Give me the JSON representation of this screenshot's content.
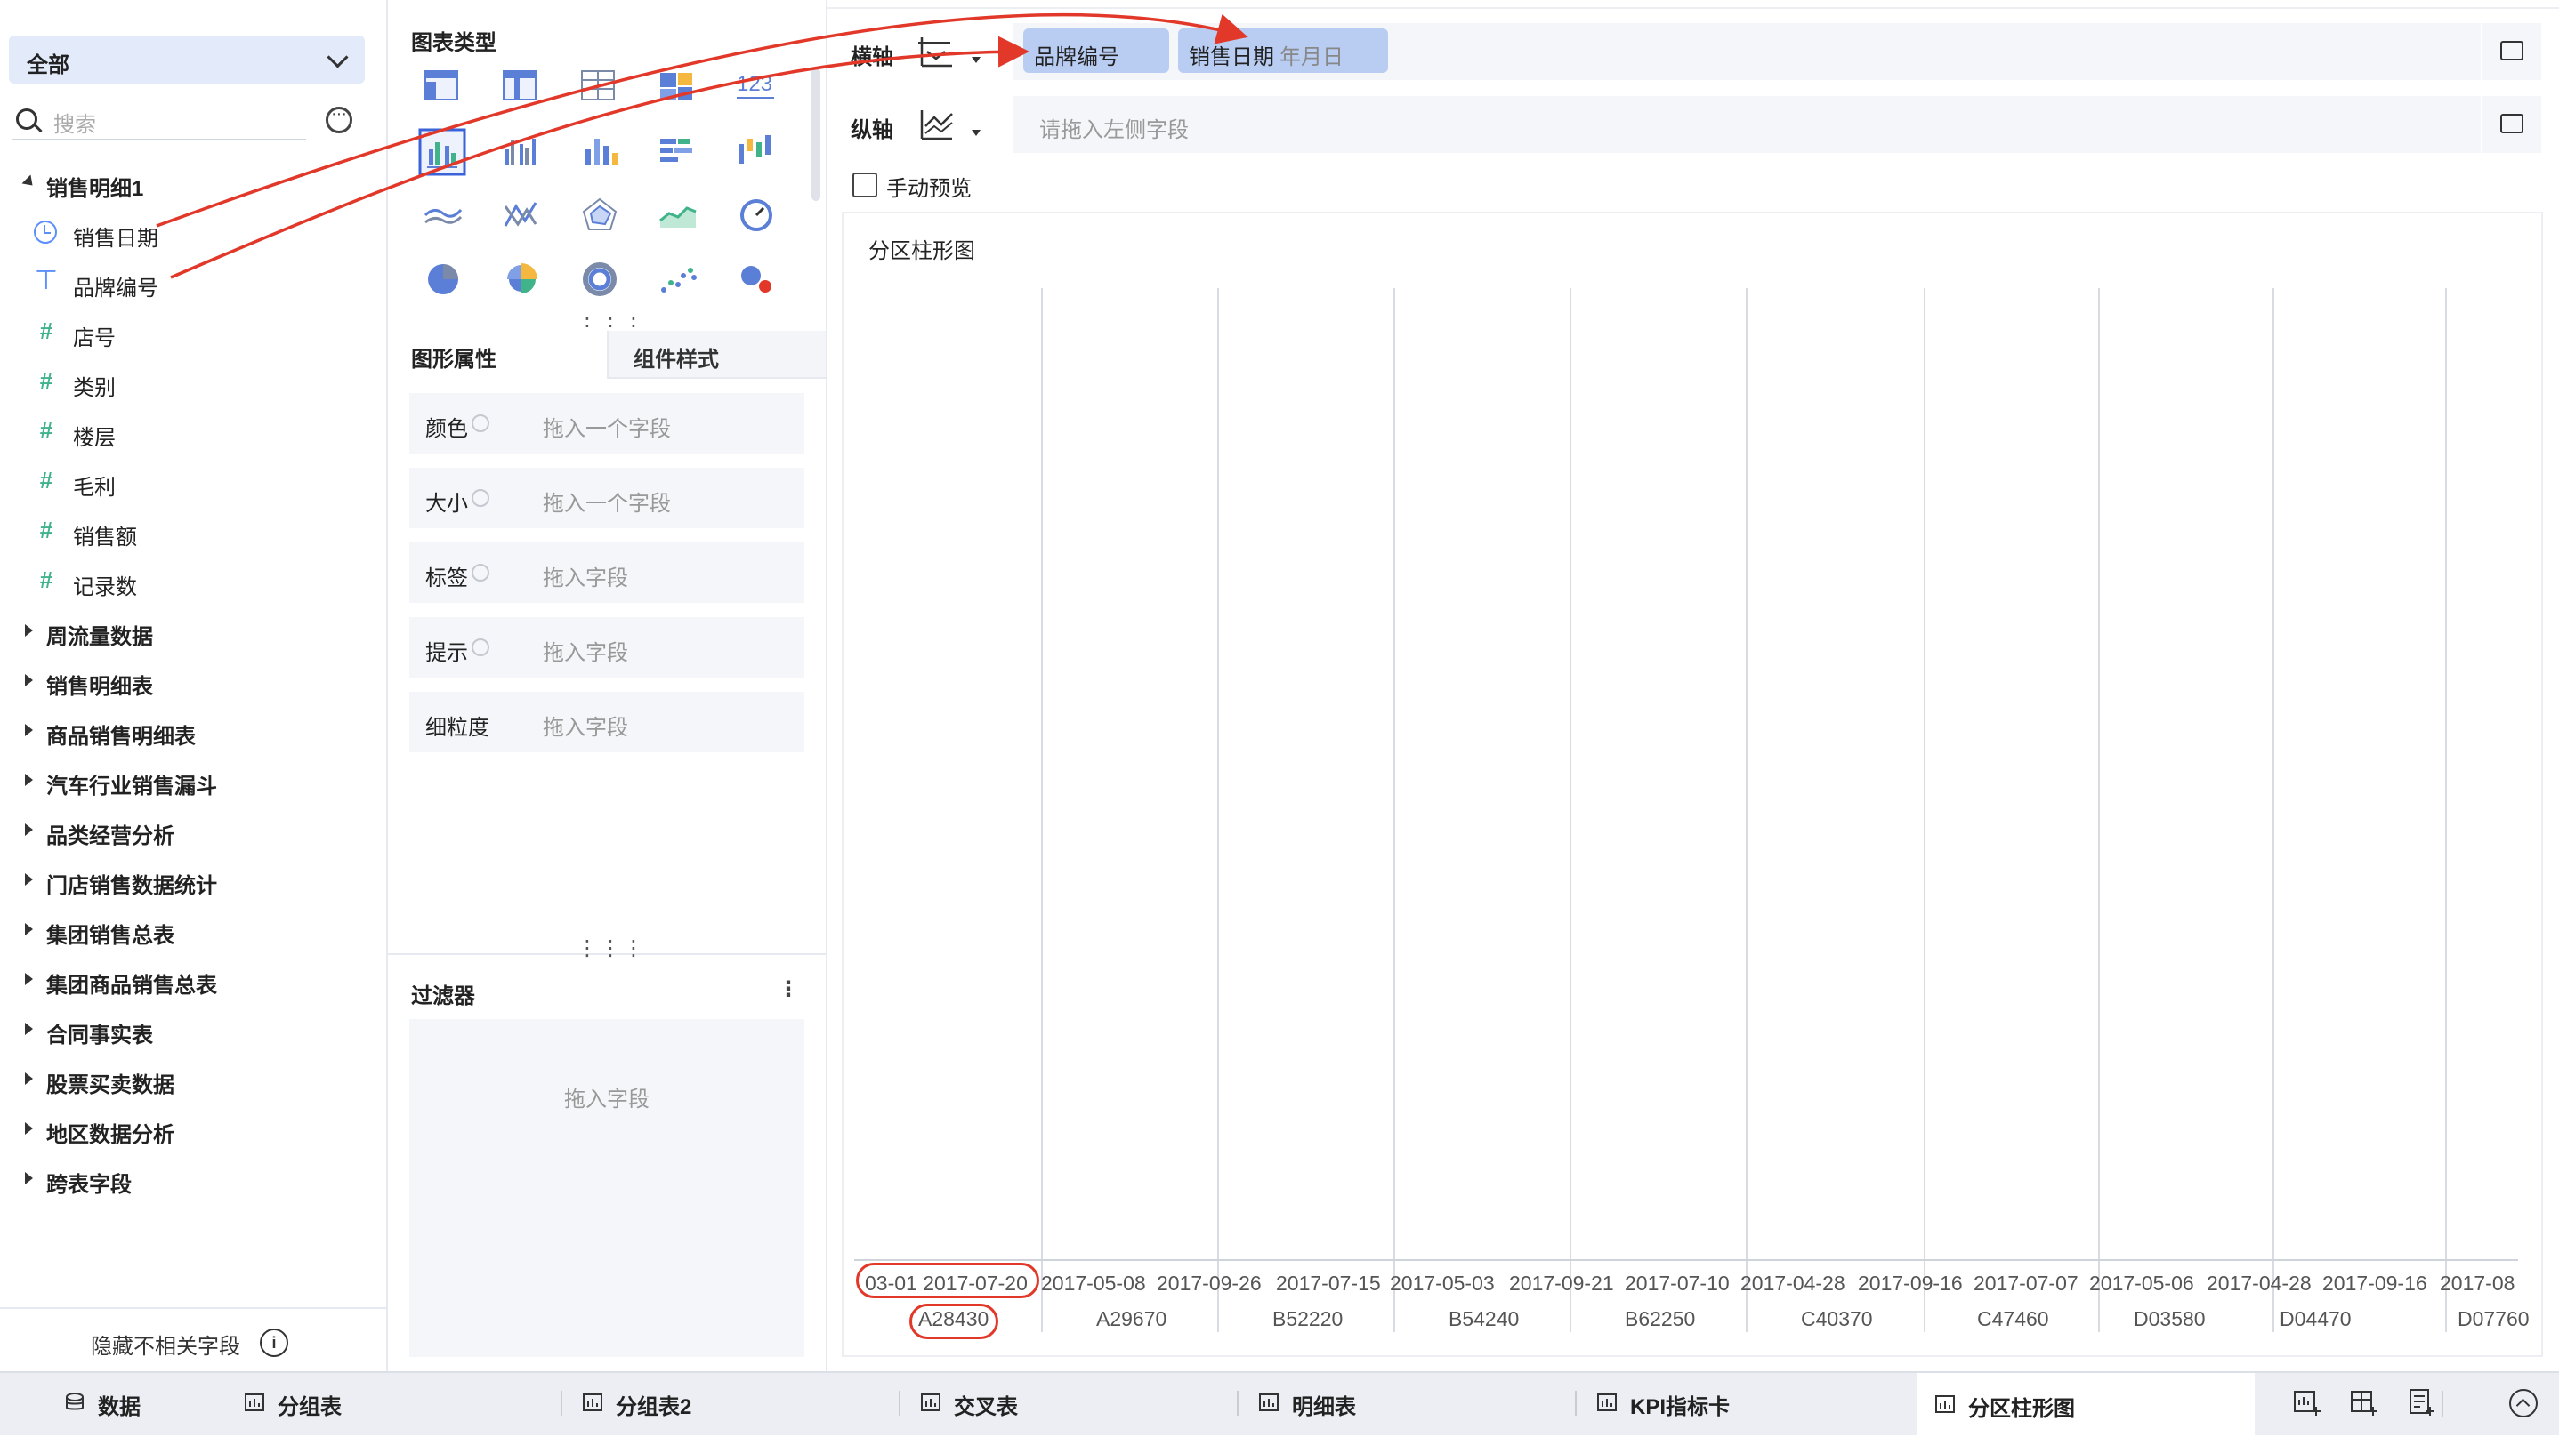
{
  "left_panel": {
    "dropdown_value": "全部",
    "search_placeholder": "搜索",
    "tree": [
      {
        "label": "销售明细1",
        "expanded": true,
        "fields": [
          {
            "label": "销售日期",
            "icon": "clock-icon"
          },
          {
            "label": "品牌编号",
            "icon": "text-field-icon"
          },
          {
            "label": "店号",
            "icon": "number-field-icon"
          },
          {
            "label": "类别",
            "icon": "number-field-icon"
          },
          {
            "label": "楼层",
            "icon": "number-field-icon"
          },
          {
            "label": "毛利",
            "icon": "number-field-icon"
          },
          {
            "label": "销售额",
            "icon": "number-field-icon"
          },
          {
            "label": "记录数",
            "icon": "record-count-icon"
          }
        ]
      },
      {
        "label": "周流量数据"
      },
      {
        "label": "销售明细表"
      },
      {
        "label": "商品销售明细表"
      },
      {
        "label": "汽车行业销售漏斗"
      },
      {
        "label": "品类经营分析"
      },
      {
        "label": "门店销售数据统计"
      },
      {
        "label": "集团销售总表"
      },
      {
        "label": "集团商品销售总表"
      },
      {
        "label": "合同事实表"
      },
      {
        "label": "股票买卖数据"
      },
      {
        "label": "地区数据分析"
      },
      {
        "label": "跨表字段"
      }
    ],
    "hide_fields_label": "隐藏不相关字段"
  },
  "middle_panel": {
    "chart_types_title": "图表类型",
    "tabs": {
      "shape_props": "图形属性",
      "component_style": "组件样式"
    },
    "props": [
      {
        "label": "颜色",
        "placeholder": "拖入一个字段"
      },
      {
        "label": "大小",
        "placeholder": "拖入一个字段"
      },
      {
        "label": "标签",
        "placeholder": "拖入字段"
      },
      {
        "label": "提示",
        "placeholder": "拖入字段"
      },
      {
        "label": "细粒度",
        "placeholder": "拖入字段"
      }
    ],
    "filter_title": "过滤器",
    "filter_placeholder": "拖入字段"
  },
  "axes": {
    "x_label": "横轴",
    "x_fields": [
      {
        "label": "品牌编号"
      },
      {
        "label": "销售日期",
        "suffix": "年月日"
      }
    ],
    "y_label": "纵轴",
    "y_placeholder": "请拖入左侧字段",
    "manual_preview": "手动预览"
  },
  "chart_title": "分区柱形图",
  "chart_data": {
    "type": "bar",
    "dates": [
      "03-01 2017-07-20",
      "2017-05-08",
      "2017-09-26",
      "2017-07-15",
      "2017-05-03",
      "2017-09-21",
      "2017-07-10",
      "2017-04-28",
      "2017-09-16",
      "2017-07-07",
      "2017-05-06",
      "2017-04-28",
      "2017-09-16",
      "2017-08"
    ],
    "categories": [
      "A28430",
      "A29670",
      "B52220",
      "B54240",
      "B62250",
      "C40370",
      "C47460",
      "D03580",
      "D04470",
      "D07760"
    ]
  },
  "bottom_tabs": [
    {
      "label": "数据",
      "icon": "database-icon"
    },
    {
      "label": "分组表",
      "icon": "table-icon"
    },
    {
      "label": "分组表2",
      "icon": "table-icon"
    },
    {
      "label": "交叉表",
      "icon": "table-icon"
    },
    {
      "label": "明细表",
      "icon": "table-icon"
    },
    {
      "label": "KPI指标卡",
      "icon": "table-icon"
    },
    {
      "label": "分区柱形图",
      "icon": "table-icon",
      "active": true
    }
  ],
  "colors": {
    "accent": "#3a63d9",
    "pill": "#b9cdf3",
    "annotation": "#e2382a"
  }
}
